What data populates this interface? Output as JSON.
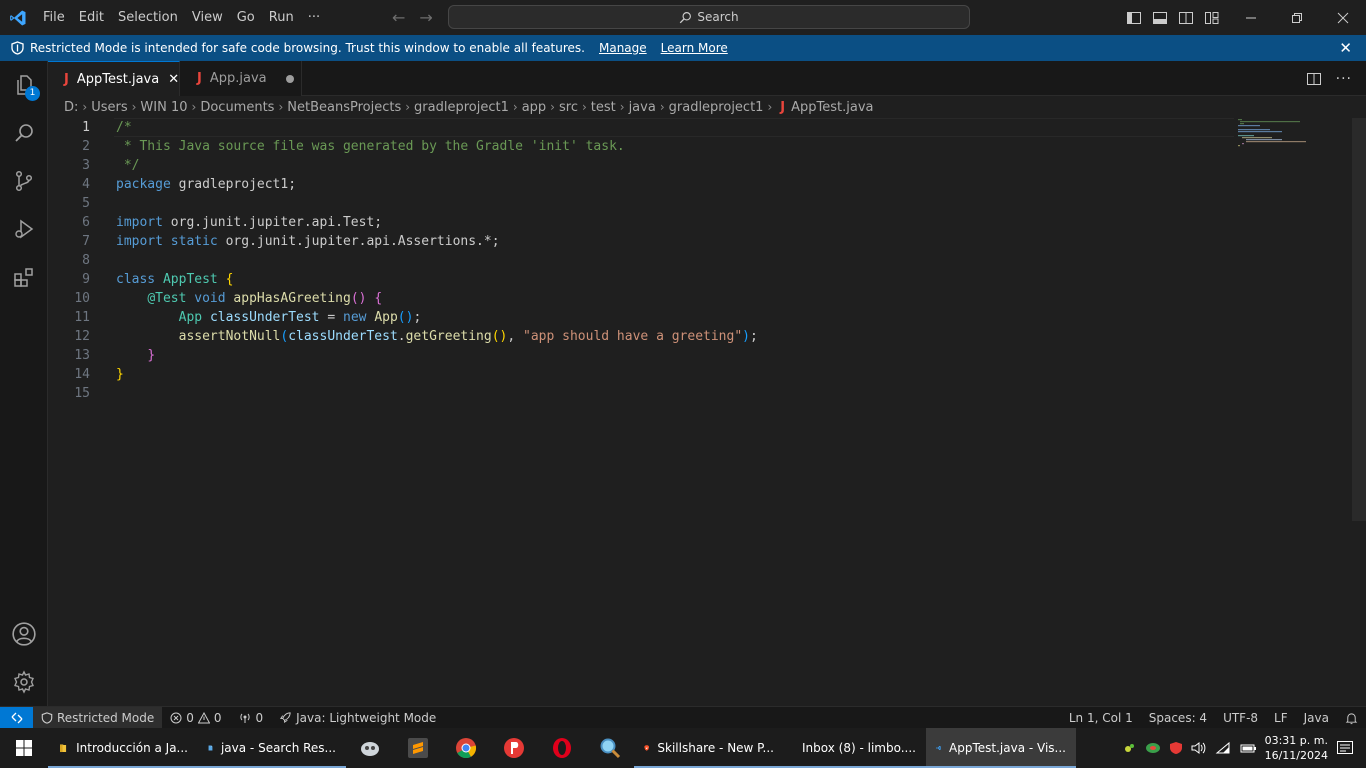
{
  "menu": [
    "File",
    "Edit",
    "Selection",
    "View",
    "Go",
    "Run",
    "···"
  ],
  "search": {
    "placeholder": "Search"
  },
  "banner": {
    "text": "Restricted Mode is intended for safe code browsing. Trust this window to enable all features.",
    "manage": "Manage",
    "learn_more": "Learn More"
  },
  "activity": {
    "explorer_badge": "1"
  },
  "tabs": [
    {
      "label": "AppTest.java",
      "active": true
    },
    {
      "label": "App.java",
      "active": false,
      "modified": true
    }
  ],
  "breadcrumb": [
    "D:",
    "Users",
    "WIN 10",
    "Documents",
    "NetBeansProjects",
    "gradleproject1",
    "app",
    "src",
    "test",
    "java",
    "gradleproject1",
    "AppTest.java"
  ],
  "editor": {
    "current_line": 1,
    "line_numbers": [
      "1",
      "2",
      "3",
      "4",
      "5",
      "6",
      "7",
      "8",
      "9",
      "10",
      "11",
      "12",
      "13",
      "14",
      "15"
    ]
  },
  "status": {
    "restricted": "Restricted Mode",
    "errors": "0",
    "warnings": "0",
    "ports": "0",
    "java": "Java: Lightweight Mode",
    "position": "Ln 1, Col 1",
    "spaces": "Spaces: 4",
    "encoding": "UTF-8",
    "eol": "LF",
    "language": "Java"
  },
  "taskbar": {
    "apps": [
      "Introducción a Ja...",
      "java - Search Res...",
      "Skillshare - New P...",
      "Inbox (8) - limbo....",
      "AppTest.java - Vis..."
    ],
    "time": "03:31 p. m.",
    "date": "16/11/2024"
  },
  "colors": {
    "accent": "#0078d4",
    "banner": "#0b4f84",
    "java_icon": "#e8453c"
  }
}
